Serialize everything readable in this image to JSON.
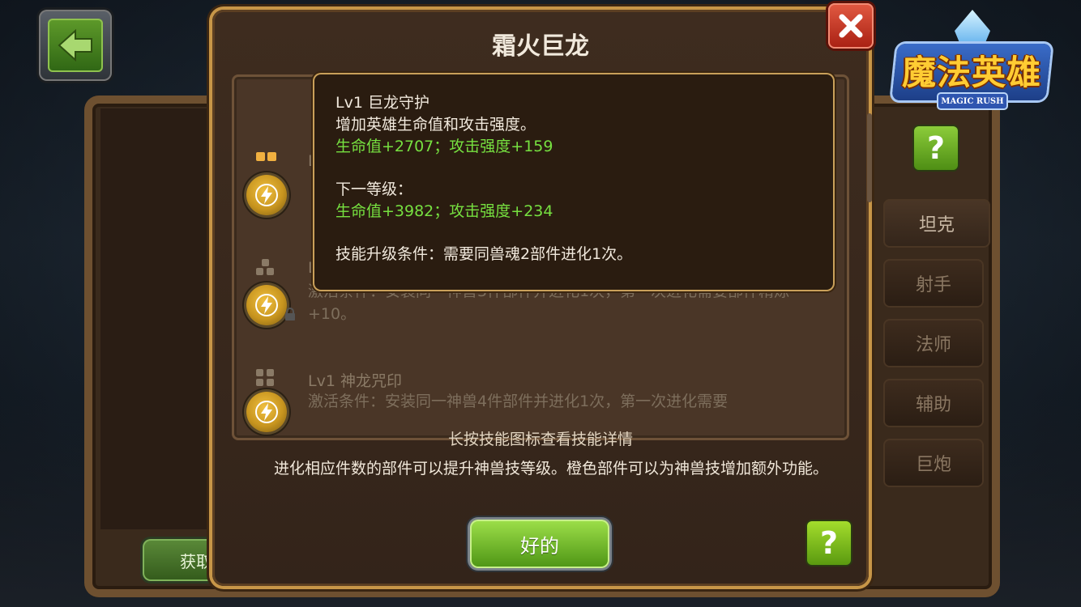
{
  "dialog": {
    "title": "霜火巨龙",
    "hint": "长按技能图标查看技能详情",
    "info": "进化相应件数的部件可以提升神兽技等级。橙色部件可以为神兽技增加额外功能。",
    "ok_label": "好的",
    "help_label": "?",
    "close_icon": "close-icon"
  },
  "tooltip": {
    "title": "Lv1 巨龙守护",
    "desc": "增加英雄生命值和攻击强度。",
    "current_bonus": "生命值+2707；攻击强度+159",
    "next_level_label": "下一等级：",
    "next_bonus": "生命值+3982；攻击强度+234",
    "upgrade_condition": "技能升级条件：需要同兽魂2部件进化1次。"
  },
  "skills": [
    {
      "partial_label": "L"
    },
    {
      "partial_label": "L",
      "desc": "激活条件：安装同一神兽3件部件并进化1次，第一次进化需要部件精炼+10。",
      "locked": true
    },
    {
      "name": "Lv1 神龙咒印",
      "desc": "激活条件：安装同一神兽4件部件并进化1次，第一次进化需要"
    }
  ],
  "background": {
    "get_label": "获取",
    "help_label": "?"
  },
  "side_tabs": [
    {
      "label": "坦克",
      "active": true
    },
    {
      "label": "射手",
      "active": false
    },
    {
      "label": "法师",
      "active": false
    },
    {
      "label": "辅助",
      "active": false
    },
    {
      "label": "巨炮",
      "active": false
    }
  ],
  "logo": {
    "title": "魔法英雄",
    "subtitle": "MAGIC RUSH"
  },
  "colors": {
    "accent_green": "#76e040",
    "gold_border": "#c79648",
    "close_red": "#c8321e"
  }
}
